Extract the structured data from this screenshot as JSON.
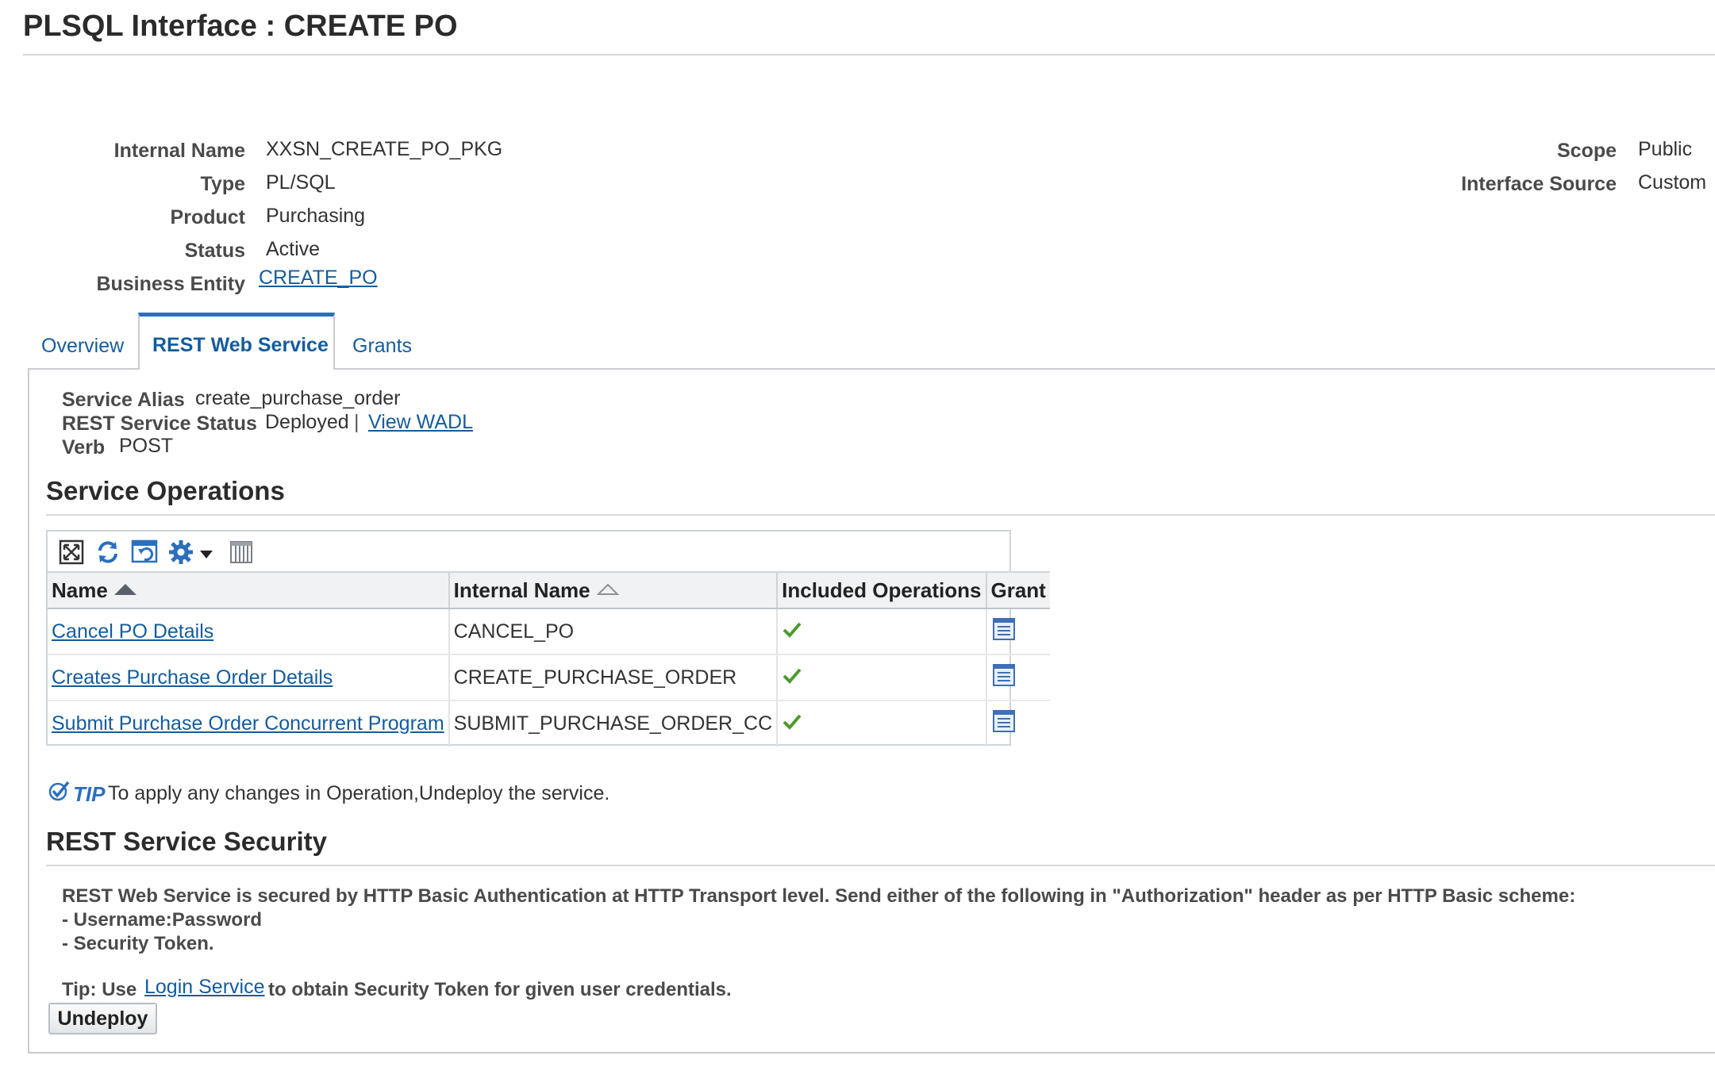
{
  "page": {
    "title": "PLSQL Interface : CREATE PO"
  },
  "details": {
    "internal_name_label": "Internal Name",
    "internal_name": "XXSN_CREATE_PO_PKG",
    "type_label": "Type",
    "type": "PL/SQL",
    "product_label": "Product",
    "product": "Purchasing",
    "status_label": "Status",
    "status": "Active",
    "business_entity_label": "Business Entity",
    "business_entity": "CREATE_PO",
    "scope_label": "Scope",
    "scope": "Public",
    "source_label": "Interface Source",
    "source": "Custom"
  },
  "tabs": [
    {
      "label": "Overview",
      "active": false
    },
    {
      "label": "REST Web Service",
      "active": true
    },
    {
      "label": "Grants",
      "active": false
    }
  ],
  "service": {
    "alias_label": "Service Alias",
    "alias": "create_purchase_order",
    "status_label": "REST Service Status",
    "status": "Deployed",
    "separator": "|",
    "wadl_link": "View WADL",
    "verb_label": "Verb",
    "verb": "POST"
  },
  "operations": {
    "title": "Service Operations",
    "toolbar_icons": [
      "detach-icon",
      "refresh-icon",
      "reset-icon",
      "settings-icon",
      "dropdown-arrow-icon",
      "columns-icon"
    ],
    "columns": [
      "Name",
      "Internal Name",
      "Included Operations",
      "Grant"
    ],
    "rows": [
      {
        "name": "Cancel PO Details",
        "internal": "CANCEL_PO",
        "included": true
      },
      {
        "name": "Creates Purchase Order Details",
        "internal": "CREATE_PURCHASE_ORDER",
        "included": true
      },
      {
        "name": "Submit Purchase Order Concurrent Program",
        "internal": "SUBMIT_PURCHASE_ORDER_CC",
        "included": true
      }
    ]
  },
  "tip": {
    "label": "TIP",
    "text": "To apply any changes in Operation,Undeploy the service."
  },
  "security": {
    "title": "REST Service Security",
    "line1": "REST Web Service is secured by HTTP Basic Authentication at HTTP Transport level. Send either of the following in \"Authorization\" header as per HTTP Basic scheme:",
    "line2": "- Username:Password",
    "line3": "- Security Token.",
    "tip_prefix": "Tip: Use",
    "tip_link": "Login Service",
    "tip_suffix": "to obtain Security Token for given user credentials."
  },
  "undeploy_button": "Undeploy",
  "colors": {
    "link": "#145c9e",
    "accent": "#2a6fbd",
    "check": "#4a9a2c"
  }
}
